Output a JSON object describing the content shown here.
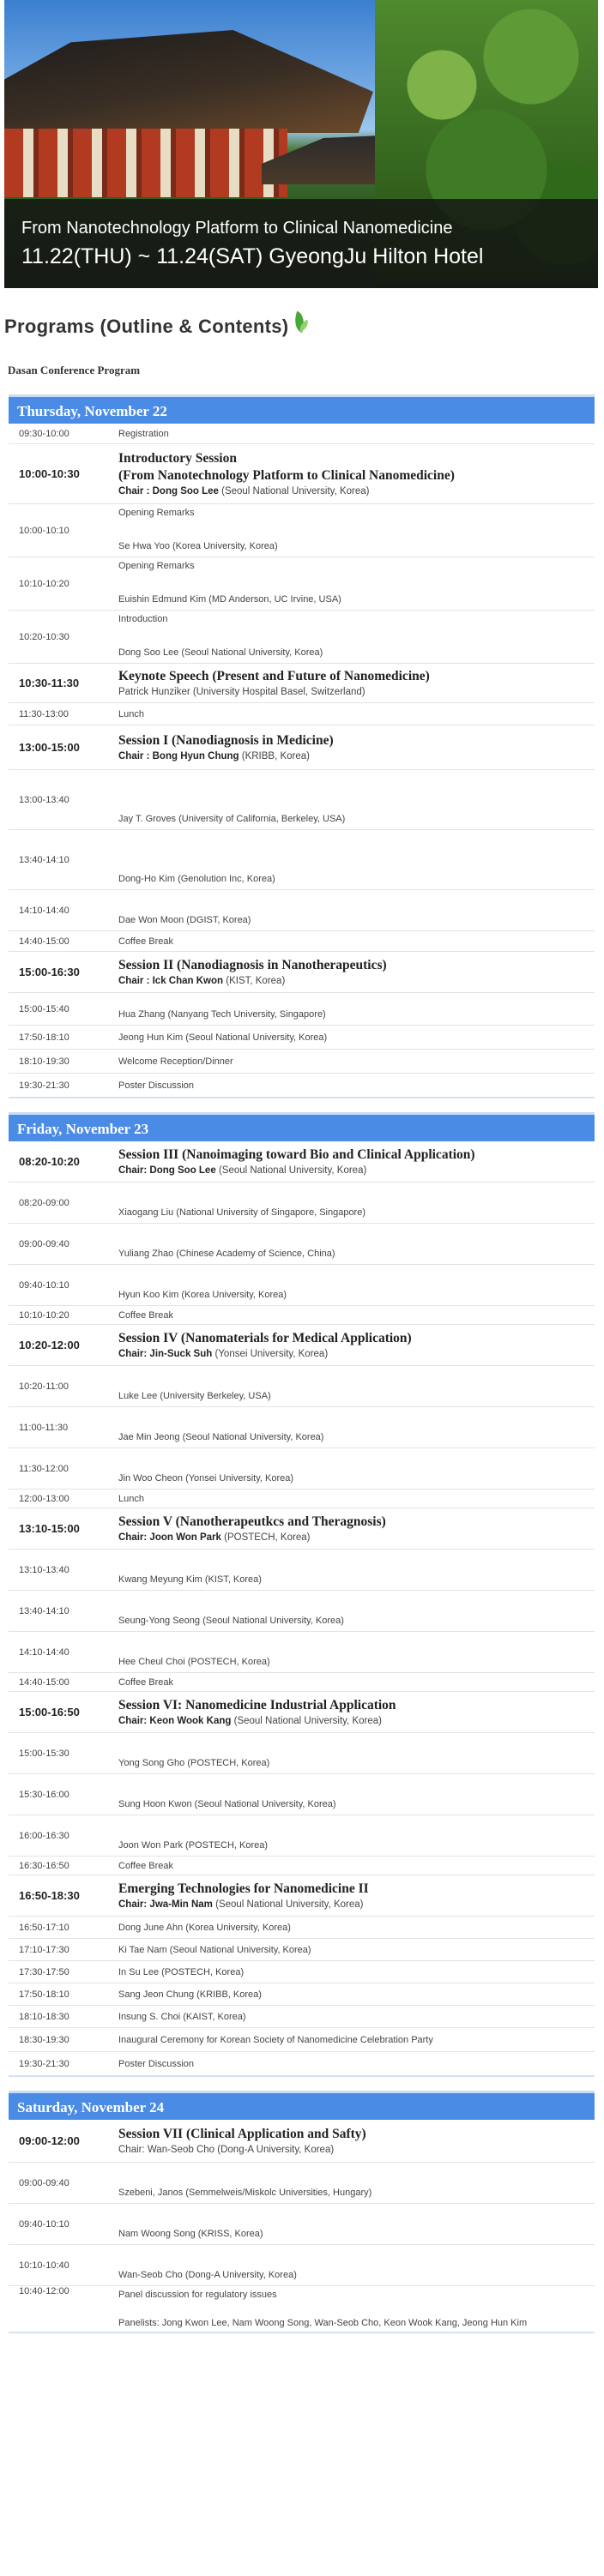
{
  "banner": {
    "line1": "From Nanotechnology Platform to Clinical Nanomedicine",
    "line2": "11.22(THU) ~ 11.24(SAT) GyeongJu Hilton Hotel"
  },
  "page_title": "Programs (Outline & Contents)",
  "subtitle": "Dasan Conference Program",
  "days": [
    {
      "label": "Thursday, November 22",
      "rows": [
        {
          "type": "simple",
          "time": "09:30-10:00",
          "text": "Registration",
          "h": 24
        },
        {
          "type": "session",
          "time": "10:00-10:30",
          "title": "Introductory Session",
          "title2": "(From Nanotechnology Platform to Clinical Nanomedicine)",
          "chair_label": "Chair : Dong Soo Lee",
          "chair_affil": "(Seoul National University, Korea)",
          "h": 70
        },
        {
          "type": "talk2",
          "time": "10:00-10:10",
          "top": "Opening Remarks",
          "bottom": "Se Hwa Yoo (Korea University, Korea)",
          "h": 62
        },
        {
          "type": "talk2",
          "time": "10:10-10:20",
          "top": "Opening Remarks",
          "bottom": "Euishin Edmund Kim (MD Anderson, UC Irvine, USA)",
          "h": 62
        },
        {
          "type": "talk2",
          "time": "10:20-10:30",
          "top": "Introduction",
          "bottom": "Dong Soo Lee (Seoul National University, Korea)",
          "h": 62
        },
        {
          "type": "session",
          "time": "10:30-11:30",
          "title": "Keynote Speech (Present and Future of Nanomedicine)",
          "title2": "",
          "chair_label": "",
          "chair_affil": "Patrick Hunziker (University Hospital Basel, Switzerland)",
          "h": 46
        },
        {
          "type": "simple",
          "time": "11:30-13:00",
          "text": "Lunch",
          "h": 26
        },
        {
          "type": "session",
          "time": "13:00-15:00",
          "title": "Session I (Nanodiagnosis in Medicine)",
          "title2": "",
          "chair_label": "Chair : Bong Hyun Chung",
          "chair_affil": "(KRIBB, Korea)",
          "h": 52
        },
        {
          "type": "talk",
          "time": "13:00-13:40",
          "bottom": "Jay T. Groves (University of California, Berkeley, USA)",
          "h": 70
        },
        {
          "type": "talk",
          "time": "13:40-14:10",
          "bottom": "Dong-Ho Kim (Genolution Inc, Korea)",
          "h": 70
        },
        {
          "type": "talk",
          "time": "14:10-14:40",
          "bottom": "Dae Won Moon (DGIST, Korea)",
          "h": 48
        },
        {
          "type": "simple",
          "time": "14:40-15:00",
          "text": "Coffee Break",
          "h": 24
        },
        {
          "type": "session",
          "time": "15:00-16:30",
          "title": "Session II (Nanodiagnosis in Nanotherapeutics)",
          "title2": "",
          "chair_label": "Chair : Ick Chan Kwon",
          "chair_affil": "(KIST, Korea)",
          "h": 48
        },
        {
          "type": "talk",
          "time": "15:00-15:40",
          "bottom": "Hua Zhang (Nanyang Tech University, Singapore)",
          "h": 38
        },
        {
          "type": "simple",
          "time": "17:50-18:10",
          "text": "Jeong Hun Kim (Seoul National University, Korea)",
          "h": 28
        },
        {
          "type": "simple",
          "time": "18:10-19:30",
          "text": "Welcome Reception/Dinner",
          "h": 28
        },
        {
          "type": "simple",
          "time": "19:30-21:30",
          "text": "Poster Discussion",
          "h": 28
        }
      ]
    },
    {
      "label": "Friday, November 23",
      "rows": [
        {
          "type": "session",
          "time": "08:20-10:20",
          "title": "Session III (Nanoimaging toward Bio and Clinical Application)",
          "title2": "",
          "chair_label": "Chair: Dong Soo Lee",
          "chair_affil": "(Seoul National University, Korea)",
          "h": 48
        },
        {
          "type": "talk",
          "time": "08:20-09:00",
          "bottom": "Xiaogang Liu (National University of Singapore, Singapore)",
          "h": 48
        },
        {
          "type": "talk",
          "time": "09:00-09:40",
          "bottom": "Yuliang Zhao (Chinese Academy of Science, China)",
          "h": 48
        },
        {
          "type": "talk",
          "time": "09:40-10:10",
          "bottom": "Hyun Koo Kim (Korea University, Korea)",
          "h": 48
        },
        {
          "type": "simple",
          "time": "10:10-10:20",
          "text": "Coffee Break",
          "h": 22
        },
        {
          "type": "session",
          "time": "10:20-12:00",
          "title": "Session IV (Nanomaterials for Medical Application)",
          "title2": "",
          "chair_label": "Chair: Jin-Suck Suh",
          "chair_affil": "(Yonsei University, Korea)",
          "h": 48
        },
        {
          "type": "talk",
          "time": "10:20-11:00",
          "bottom": "Luke Lee (University Berkeley, USA)",
          "h": 48
        },
        {
          "type": "talk",
          "time": "11:00-11:30",
          "bottom": "Jae Min Jeong (Seoul National University, Korea)",
          "h": 48
        },
        {
          "type": "talk",
          "time": "11:30-12:00",
          "bottom": "Jin Woo Cheon (Yonsei University, Korea)",
          "h": 48
        },
        {
          "type": "simple",
          "time": "12:00-13:00",
          "text": "Lunch",
          "h": 22
        },
        {
          "type": "session",
          "time": "13:10-15:00",
          "title": "Session V (Nanotherapeutkcs and Theragnosis)",
          "title2": "",
          "chair_label": "Chair: Joon Won Park",
          "chair_affil": "(POSTECH, Korea)",
          "h": 48
        },
        {
          "type": "talk",
          "time": "13:10-13:40",
          "bottom": "Kwang Meyung Kim (KIST, Korea)",
          "h": 48
        },
        {
          "type": "talk",
          "time": "13:40-14:10",
          "bottom": "Seung-Yong Seong (Seoul National University, Korea)",
          "h": 48
        },
        {
          "type": "talk",
          "time": "14:10-14:40",
          "bottom": "Hee Cheul Choi (POSTECH, Korea)",
          "h": 48
        },
        {
          "type": "simple",
          "time": "14:40-15:00",
          "text": "Coffee Break",
          "h": 22
        },
        {
          "type": "session",
          "time": "15:00-16:50",
          "title": "Session VI: Nanomedicine Industrial Application",
          "title2": "",
          "chair_label": "Chair: Keon Wook Kang",
          "chair_affil": "(Seoul National University, Korea)",
          "h": 48
        },
        {
          "type": "talk",
          "time": "15:00-15:30",
          "bottom": "Yong Song Gho (POSTECH, Korea)",
          "h": 48
        },
        {
          "type": "talk",
          "time": "15:30-16:00",
          "bottom": "Sung Hoon Kwon (Seoul National University, Korea)",
          "h": 48
        },
        {
          "type": "talk",
          "time": "16:00-16:30",
          "bottom": "Joon Won Park (POSTECH, Korea)",
          "h": 48
        },
        {
          "type": "simple",
          "time": "16:30-16:50",
          "text": "Coffee Break",
          "h": 22
        },
        {
          "type": "session",
          "time": "16:50-18:30",
          "title": "Emerging Technologies for Nanomedicine II",
          "title2": "",
          "chair_label": "Chair: Jwa-Min Nam",
          "chair_affil": "(Seoul National University, Korea)",
          "h": 48
        },
        {
          "type": "simple",
          "time": "16:50-17:10",
          "text": "Dong June Ahn (Korea University, Korea)",
          "h": 26
        },
        {
          "type": "simple",
          "time": "17:10-17:30",
          "text": "Ki Tae Nam (Seoul National University, Korea)",
          "h": 26
        },
        {
          "type": "simple",
          "time": "17:30-17:50",
          "text": "In Su Lee (POSTECH, Korea)",
          "h": 26
        },
        {
          "type": "simple",
          "time": "17:50-18:10",
          "text": "Sang Jeon Chung (KRIBB, Korea)",
          "h": 26
        },
        {
          "type": "simple",
          "time": "18:10-18:30",
          "text": "Insung S. Choi (KAIST, Korea)",
          "h": 26
        },
        {
          "type": "simple",
          "time": "18:30-19:30",
          "text": "Inaugural Ceremony for Korean Society of Nanomedicine Celebration Party",
          "h": 28
        },
        {
          "type": "simple",
          "time": "19:30-21:30",
          "text": "Poster Discussion",
          "h": 28
        }
      ]
    },
    {
      "label": "Saturday, November 24",
      "rows": [
        {
          "type": "session",
          "time": "09:00-12:00",
          "title": "Session VII (Clinical Application and Safty)",
          "title2": "",
          "chair_label": "",
          "chair_affil": "Chair: Wan-Seob Cho (Dong-A University, Korea)",
          "h": 50
        },
        {
          "type": "talk",
          "time": "09:00-09:40",
          "bottom": "Szebeni, Janos (Semmelweis/Miskolc Universities, Hungary)",
          "h": 48
        },
        {
          "type": "talk",
          "time": "09:40-10:10",
          "bottom": "Nam Woong Song (KRISS, Korea)",
          "h": 48
        },
        {
          "type": "talk",
          "time": "10:10-10:40",
          "bottom": "Wan-Seob Cho (Dong-A University, Korea)",
          "h": 48
        },
        {
          "type": "panel",
          "time": "10:40-12:00",
          "top": "Panel discussion for regulatory issues",
          "bottom": "Panelists: Jong Kwon Lee, Nam Woong Song, Wan-Seob Cho, Keon Wook Kang, Jeong Hun Kim",
          "h": 54
        }
      ]
    }
  ]
}
